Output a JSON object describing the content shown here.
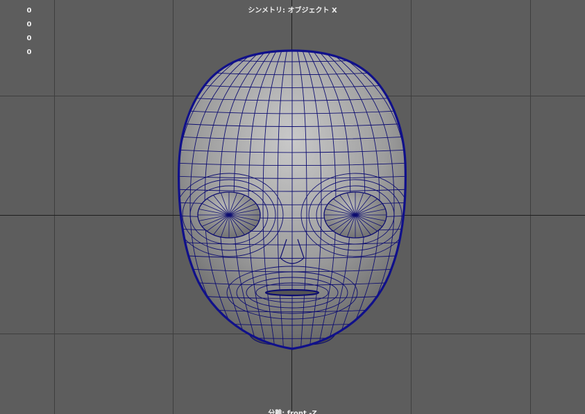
{
  "viewport": {
    "hud_counts": [
      "0",
      "0",
      "0",
      "0"
    ],
    "symmetry_label": "シンメトリ: オブジェクト X",
    "camera_label": "分離: front -Z",
    "background_color": "#5d5d5d",
    "grid_color": "#3e3e3e",
    "wireframe_color": "#0d0d70"
  }
}
